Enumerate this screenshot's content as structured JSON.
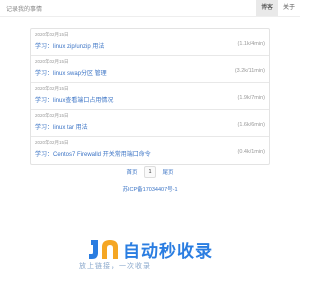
{
  "header": {
    "site_title": "记录我的事情",
    "nav": [
      "博客",
      "关于"
    ]
  },
  "posts": [
    {
      "date": "2020年02月15日",
      "title": "学习：linux zip/unzip 用法",
      "meta": "(1.1k/4min)"
    },
    {
      "date": "2020年02月15日",
      "title": "学习：linux swap分区 管理",
      "meta": "(3.2k/11min)"
    },
    {
      "date": "2020年02月15日",
      "title": "学习：linux查看端口占用情况",
      "meta": "(1.9k/7min)"
    },
    {
      "date": "2020年02月15日",
      "title": "学习：linux tar 用法",
      "meta": "(1.6k/6min)"
    },
    {
      "date": "2020年02月15日",
      "title": "学习：Centos7 Firewalld 开关常用端口命令",
      "meta": "(0.4k/1min)"
    }
  ],
  "pagination": {
    "first": "首页",
    "current": "1",
    "last": "尾页"
  },
  "footer": {
    "icp": "苏ICP备17034407号-1"
  },
  "watermark": {
    "name": "自动秒收录",
    "slogan": "放上链接，一次收录"
  },
  "colors": {
    "link": "#3a73c5",
    "brand": "#2a7de1"
  }
}
